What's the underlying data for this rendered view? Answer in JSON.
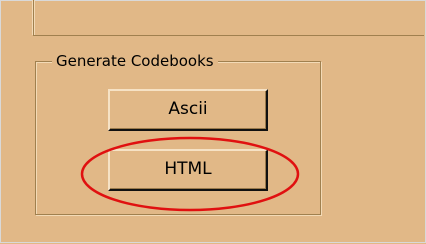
{
  "groupbox": {
    "title": "Generate Codebooks"
  },
  "buttons": {
    "ascii_label": "Ascii",
    "html_label": "HTML"
  },
  "colors": {
    "background": "#e1b887",
    "highlight": "#e01010"
  }
}
